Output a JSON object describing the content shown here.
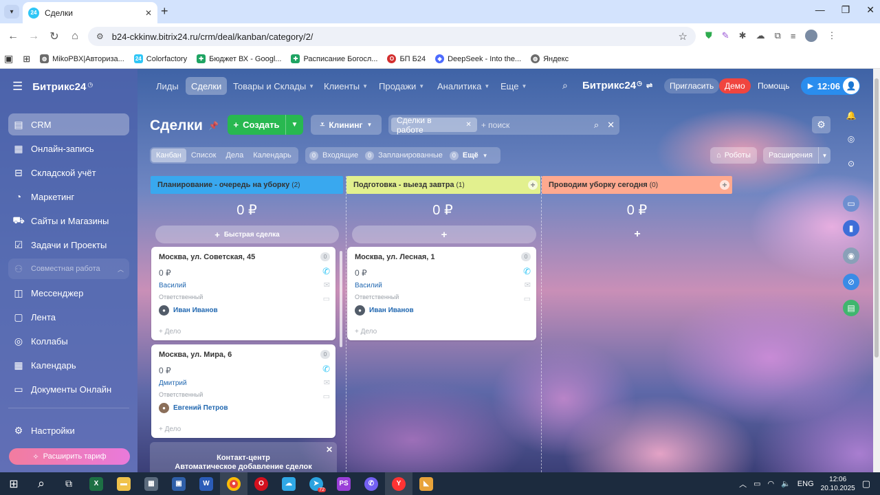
{
  "browser": {
    "tab_title": "Сделки",
    "tab_favicon": "24",
    "url": "b24-ckkinw.bitrix24.ru/crm/deal/kanban/category/2/",
    "bookmarks": [
      {
        "label": "MikoPBX|Авториза...",
        "icon": "globe-icon",
        "color": "#6b6b6b"
      },
      {
        "label": "Colorfactory",
        "icon": "bitrix-icon",
        "color": "#2fc6f6"
      },
      {
        "label": "Бюджет ВХ - Googl...",
        "icon": "sheets-icon",
        "color": "#1fa463"
      },
      {
        "label": "Расписание Богосл...",
        "icon": "sheets-icon",
        "color": "#1fa463"
      },
      {
        "label": "БП Б24",
        "icon": "opera-icon",
        "color": "#d32f2f"
      },
      {
        "label": "DeepSeek - Into the...",
        "icon": "deepseek-icon",
        "color": "#4d6bfe"
      },
      {
        "label": "Яндекс",
        "icon": "globe-icon",
        "color": "#6b6b6b"
      }
    ]
  },
  "sidebar": {
    "logo": "Битрикс24",
    "items": [
      {
        "label": "CRM",
        "icon": "crm-icon"
      },
      {
        "label": "Онлайн-запись",
        "icon": "calendar-check-icon"
      },
      {
        "label": "Складской учёт",
        "icon": "warehouse-icon"
      },
      {
        "label": "Маркетинг",
        "icon": "marketing-icon"
      },
      {
        "label": "Сайты и Магазины",
        "icon": "cart-icon"
      },
      {
        "label": "Задачи и Проекты",
        "icon": "task-icon"
      },
      {
        "label": "Совместная работа",
        "icon": "people-icon"
      },
      {
        "label": "Мессенджер",
        "icon": "chat-icon"
      },
      {
        "label": "Лента",
        "icon": "feed-icon"
      },
      {
        "label": "Коллабы",
        "icon": "collab-icon"
      },
      {
        "label": "Календарь",
        "icon": "calendar-icon"
      },
      {
        "label": "Документы Онлайн",
        "icon": "document-icon"
      }
    ],
    "settings": "Настройки",
    "upgrade": "Расширить тариф"
  },
  "topnav": {
    "items": [
      "Лиды",
      "Сделки",
      "Товары и Склады",
      "Клиенты",
      "Продажи",
      "Аналитика",
      "Еще"
    ],
    "brand": "Битрикс24",
    "invite": "Пригласить",
    "demo": "Демо",
    "help": "Помощь",
    "time": "12:06"
  },
  "page": {
    "title": "Сделки",
    "create": "Создать",
    "pipeline": "Клининг",
    "filter_chip": "Сделки в работе",
    "search_placeholder": "+ поиск",
    "views": [
      "Канбан",
      "Список",
      "Дела",
      "Календарь"
    ],
    "counters": [
      {
        "n": "0",
        "label": "Входящие"
      },
      {
        "n": "0",
        "label": "Запланированные"
      },
      {
        "n": "0",
        "label": "Ещё"
      }
    ],
    "robots": "Роботы",
    "extensions": "Расширения"
  },
  "columns": [
    {
      "title": "Планирование - очередь на уборку",
      "count": "(2)",
      "sum": "0 ₽",
      "color": "#39a8ef",
      "quick": "Быстрая сделка"
    },
    {
      "title": "Подготовка - выезд завтра",
      "count": "(1)",
      "sum": "0 ₽",
      "color": "#e2f08e",
      "quick": "+"
    },
    {
      "title": "Проводим уборку сегодня",
      "count": "(0)",
      "sum": "0 ₽",
      "color": "#ffa98f",
      "quick": "+"
    }
  ],
  "cards": [
    {
      "title": "Москва, ул. Советская, 45",
      "price": "0 ₽",
      "contact": "Василий",
      "role": "Ответственный",
      "person": "Иван Иванов",
      "activity": "+ Дело",
      "badge": "0"
    },
    {
      "title": "Москва, ул. Мира, 6",
      "price": "0 ₽",
      "contact": "Дмитрий",
      "role": "Ответственный",
      "person": "Евгений Петров",
      "activity": "+ Дело",
      "badge": "0"
    },
    {
      "title": "Москва, ул. Лесная, 1",
      "price": "0 ₽",
      "contact": "Василий",
      "role": "Ответственный",
      "person": "Иван Иванов",
      "activity": "+ Дело",
      "badge": "0"
    }
  ],
  "promo": {
    "line1": "Контакт-центр",
    "line2": "Автоматическое добавление сделок"
  },
  "taskbar": {
    "lang": "ENG",
    "time": "12:06",
    "date": "20.10.2025",
    "telegram_badge": "72"
  }
}
